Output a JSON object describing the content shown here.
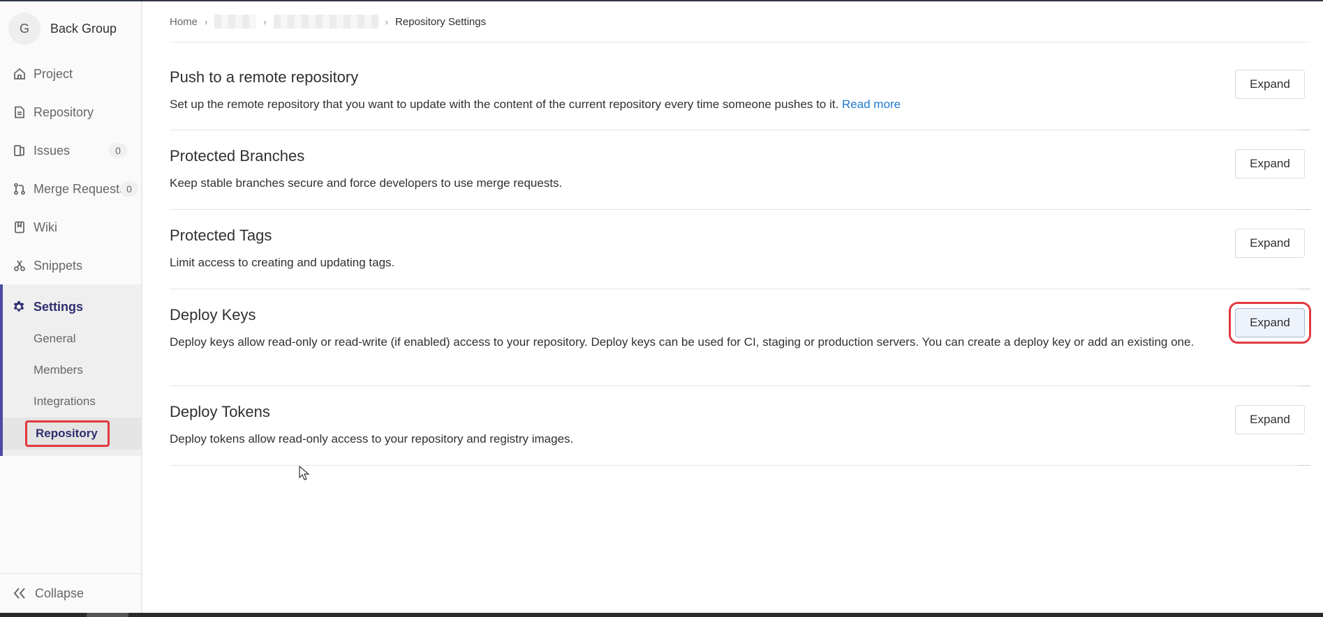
{
  "sidebar": {
    "group": {
      "avatar_letter": "G",
      "name": "Back Group"
    },
    "items": [
      {
        "label": "Project",
        "icon": "home-icon"
      },
      {
        "label": "Repository",
        "icon": "document-icon"
      },
      {
        "label": "Issues",
        "icon": "issues-icon",
        "badge": "0"
      },
      {
        "label": "Merge Requests",
        "icon": "merge-request-icon",
        "badge": "0"
      },
      {
        "label": "Wiki",
        "icon": "book-icon"
      },
      {
        "label": "Snippets",
        "icon": "scissors-icon"
      }
    ],
    "settings": {
      "label": "Settings",
      "icon": "gear-icon",
      "subitems": [
        "General",
        "Members",
        "Integrations",
        "Repository"
      ],
      "active": "Repository"
    },
    "collapse_label": "Collapse"
  },
  "breadcrumb": {
    "home": "Home",
    "current": "Repository Settings"
  },
  "sections": [
    {
      "title": "Push to a remote repository",
      "description": "Set up the remote repository that you want to update with the content of the current repository every time someone pushes to it.",
      "link": "Read more",
      "button": "Expand"
    },
    {
      "title": "Protected Branches",
      "description": "Keep stable branches secure and force developers to use merge requests.",
      "button": "Expand"
    },
    {
      "title": "Protected Tags",
      "description": "Limit access to creating and updating tags.",
      "button": "Expand"
    },
    {
      "title": "Deploy Keys",
      "description": "Deploy keys allow read-only or read-write (if enabled) access to your repository. Deploy keys can be used for CI, staging or production servers. You can create a deploy key or add an existing one.",
      "button": "Expand"
    },
    {
      "title": "Deploy Tokens",
      "description": "Deploy tokens allow read-only access to your repository and registry images.",
      "button": "Expand"
    }
  ],
  "colors": {
    "accent": "#4b4ba3",
    "link": "#1f78d1",
    "highlight": "#e0393e"
  }
}
